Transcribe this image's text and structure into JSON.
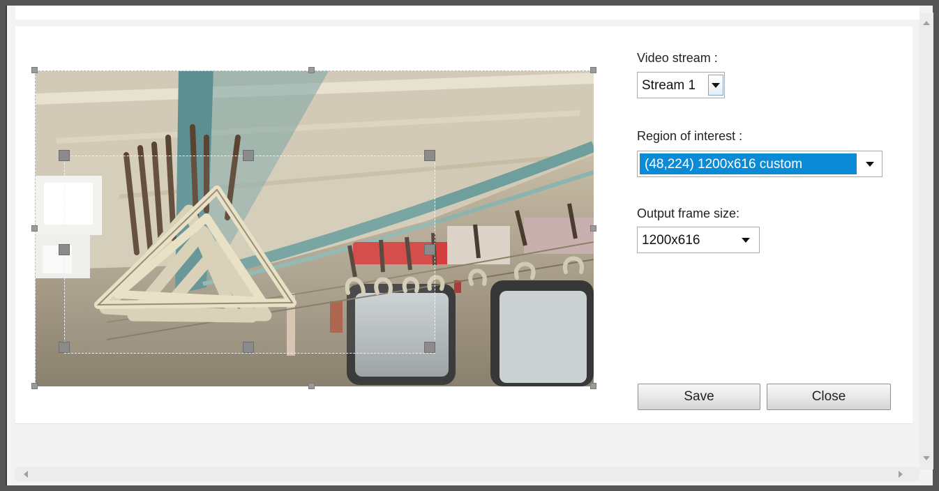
{
  "settings": {
    "video_stream": {
      "label": "Video stream :",
      "value": "Stream 1"
    },
    "region_of_interest": {
      "label": "Region of interest :",
      "value": "(48,224) 1200x616 custom"
    },
    "output_frame_size": {
      "label": "Output frame size:",
      "value": "1200x616"
    }
  },
  "buttons": {
    "save": "Save",
    "close": "Close"
  },
  "colors": {
    "selection": "#0b8ad6",
    "background": "#ffffff"
  },
  "icons": {
    "dropdown": "chevron-down-icon",
    "scroll_up": "scroll-up-icon",
    "scroll_down": "scroll-down-icon",
    "scroll_left": "scroll-left-icon",
    "scroll_right": "scroll-right-icon"
  }
}
